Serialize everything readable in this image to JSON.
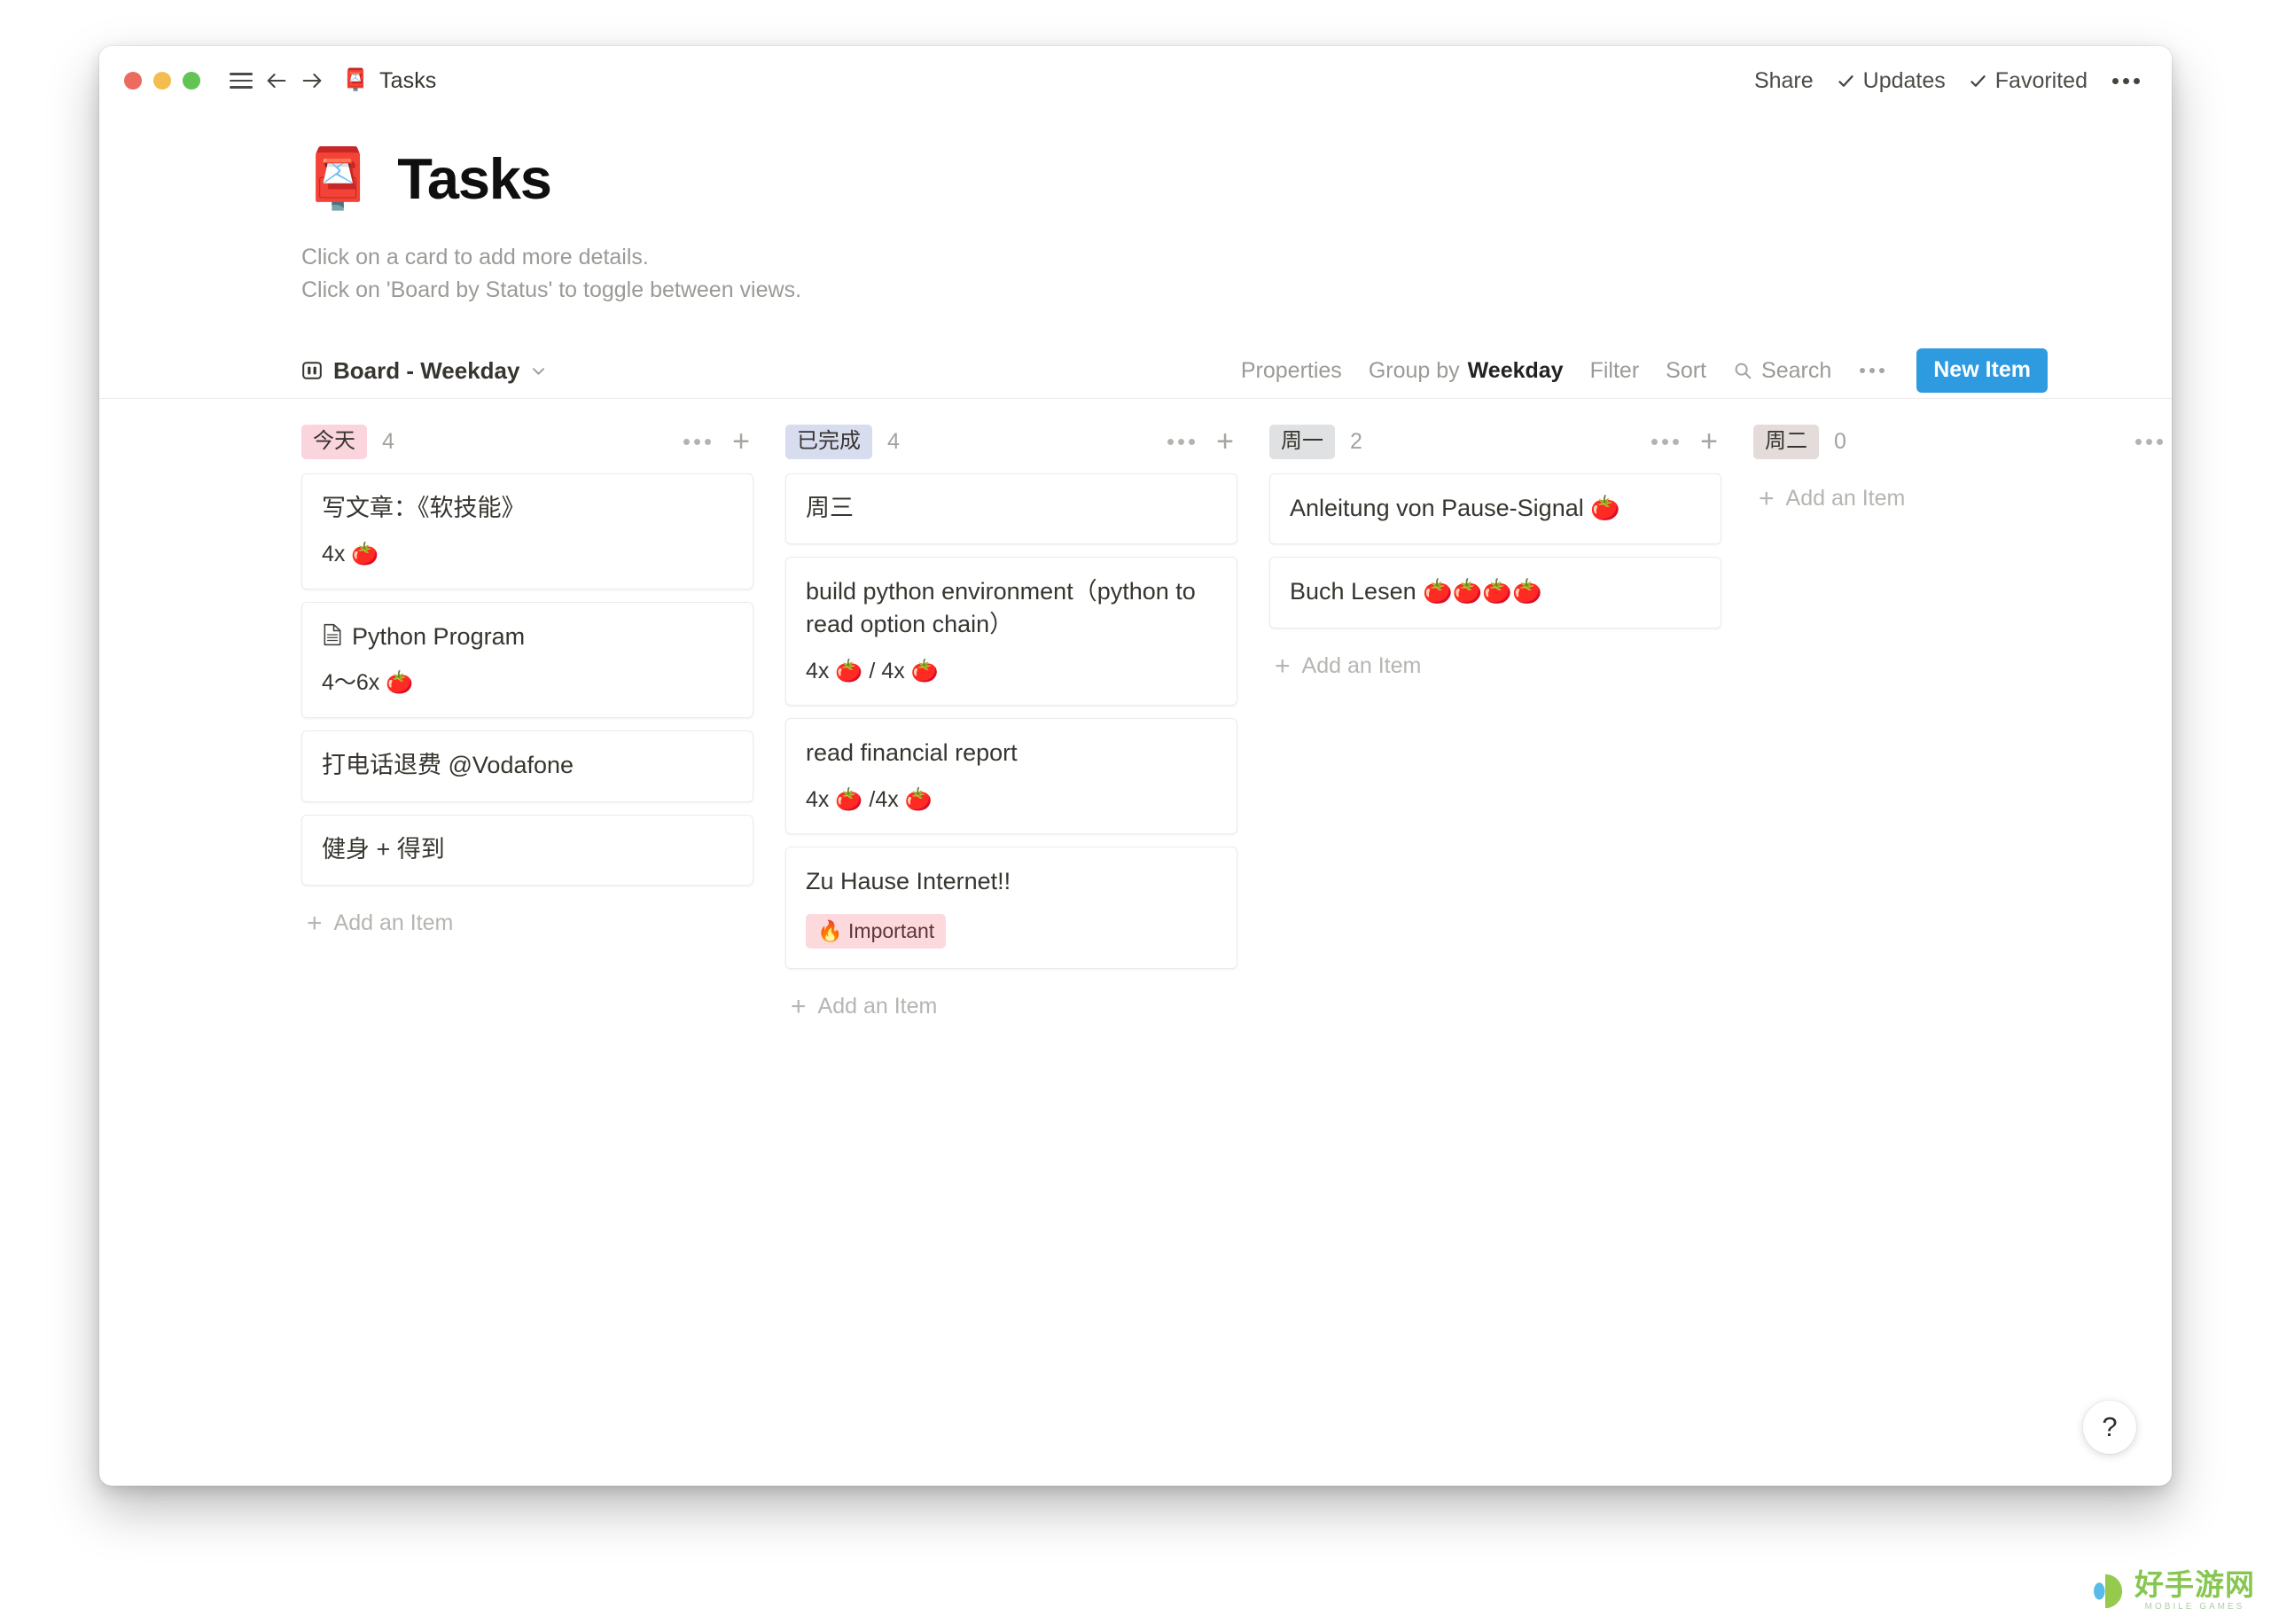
{
  "titlebar": {
    "traffic_lights": [
      "close",
      "minimize",
      "zoom"
    ],
    "menu_icon": "hamburger-icon",
    "back_icon": "arrow-left-icon",
    "forward_icon": "arrow-right-icon",
    "doc_emoji": "📮",
    "doc_title": "Tasks",
    "share_label": "Share",
    "updates_label": "Updates",
    "favorited_label": "Favorited",
    "more_label": "•••"
  },
  "page": {
    "emoji": "📮",
    "title": "Tasks",
    "subtitle_line1": "Click on a card to add more details.",
    "subtitle_line2": "Click on 'Board by Status' to toggle between views."
  },
  "view_toolbar": {
    "view_name": "Board - Weekday",
    "properties_label": "Properties",
    "group_by_label": "Group by",
    "group_by_value": "Weekday",
    "filter_label": "Filter",
    "sort_label": "Sort",
    "search_label": "Search",
    "more_label": "•••",
    "new_item_label": "New Item",
    "accent_color": "#2e9ae0"
  },
  "board": {
    "add_item_label": "Add an Item",
    "columns": [
      {
        "name": "今天",
        "count": "4",
        "badge_color": "#fbd5de",
        "cards": [
          {
            "title": "写文章：《软技能》",
            "meta": "4x 🍅",
            "icon": null,
            "tag": null
          },
          {
            "title": "Python Program",
            "meta": "4～6x 🍅",
            "icon": "page-icon",
            "tag": null
          },
          {
            "title": "打电话退费 @Vodafone",
            "meta": null,
            "icon": null,
            "tag": null
          },
          {
            "title": "健身 + 得到",
            "meta": null,
            "icon": null,
            "tag": null
          }
        ]
      },
      {
        "name": "已完成",
        "count": "4",
        "badge_color": "#d8dcef",
        "cards": [
          {
            "title": "周三",
            "meta": null,
            "icon": null,
            "tag": null
          },
          {
            "title": "build python environment（python to read option chain）",
            "meta": "4x 🍅 / 4x 🍅",
            "icon": null,
            "tag": null
          },
          {
            "title": "read financial report",
            "meta": "4x 🍅 /4x 🍅",
            "icon": null,
            "tag": null
          },
          {
            "title": "Zu Hause Internet!!",
            "meta": null,
            "icon": null,
            "tag": "🔥 Important"
          }
        ]
      },
      {
        "name": "周一",
        "count": "2",
        "badge_color": "#dfe1e3",
        "cards": [
          {
            "title": "Anleitung von Pause-Signal 🍅",
            "meta": null,
            "icon": null,
            "tag": null
          },
          {
            "title": "Buch Lesen 🍅🍅🍅🍅",
            "meta": null,
            "icon": null,
            "tag": null
          }
        ]
      },
      {
        "name": "周二",
        "count": "0",
        "badge_color": "#e4dcda",
        "cards": []
      }
    ]
  },
  "help": {
    "label": "?"
  },
  "watermark": {
    "cn": "好手游网",
    "en": "MOBILE GAMES"
  }
}
